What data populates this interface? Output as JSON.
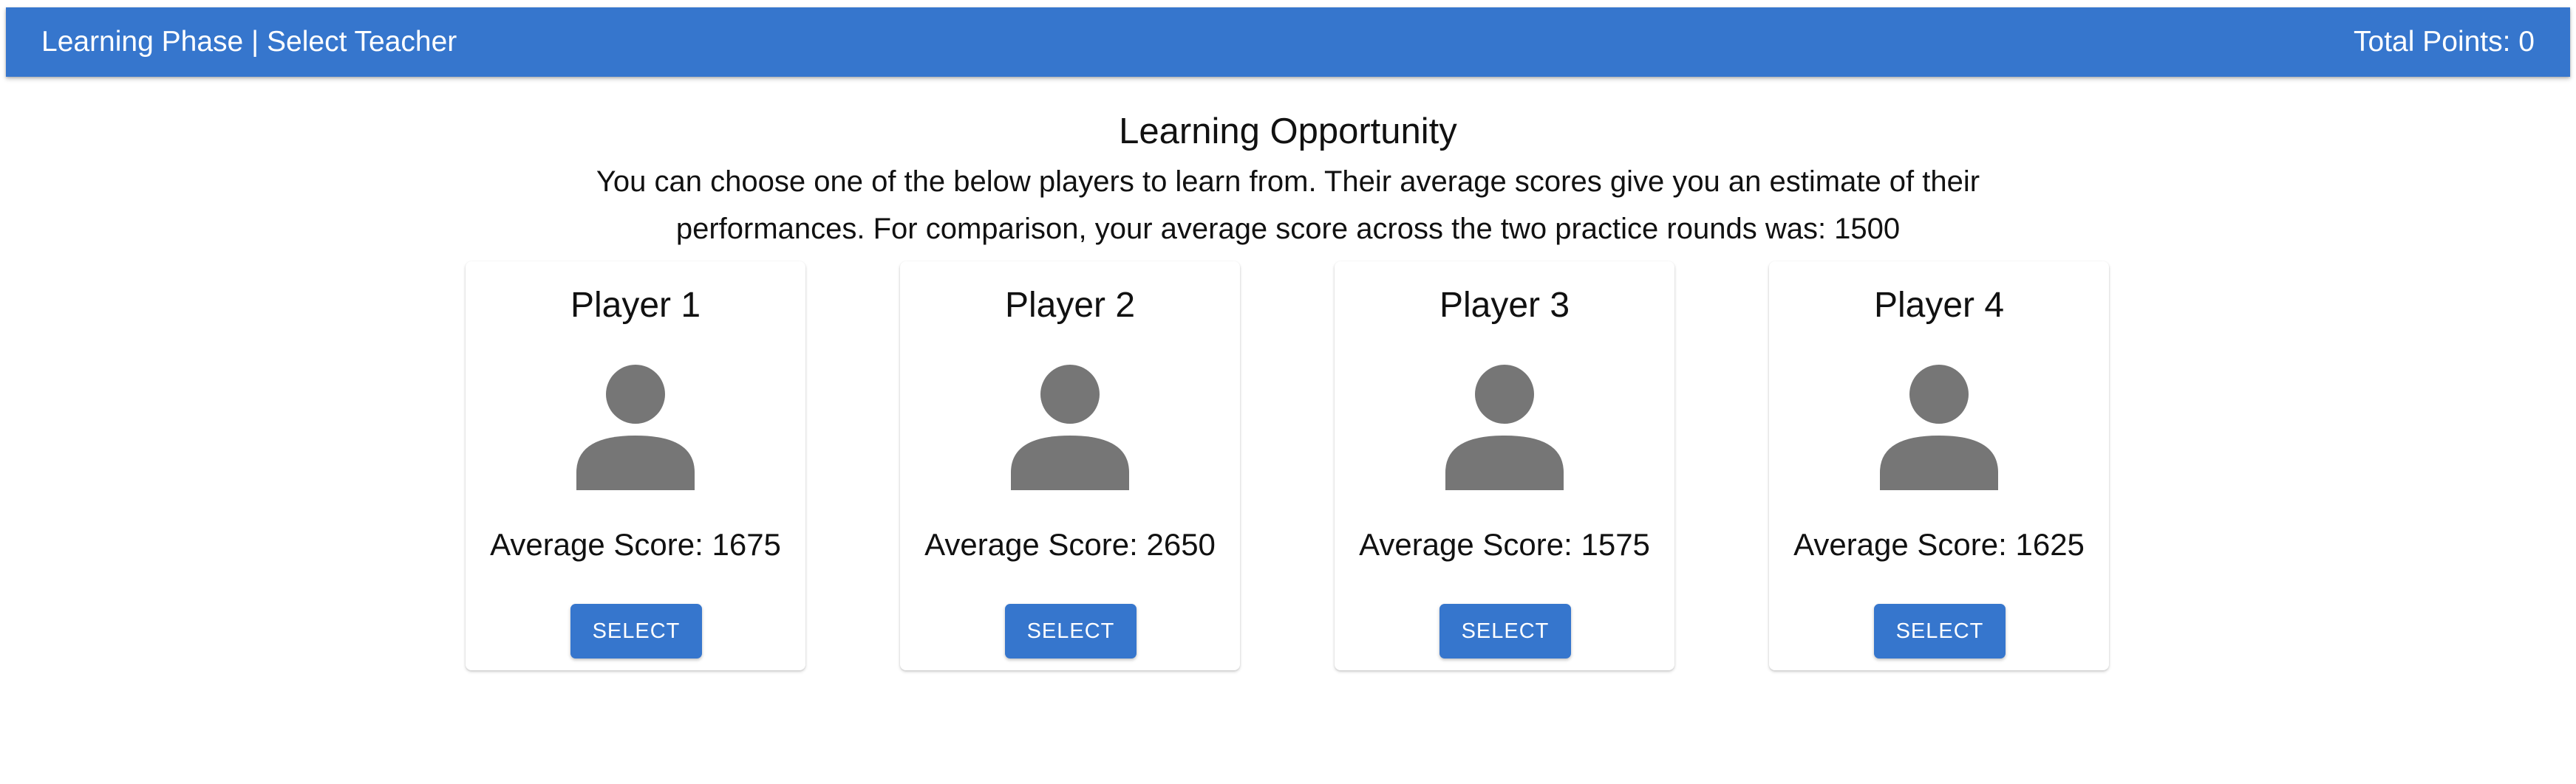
{
  "appbar": {
    "title": "Learning Phase | Select Teacher",
    "points": "Total Points: 0"
  },
  "main": {
    "heading": "Learning Opportunity",
    "description": "You can choose one of the below players to learn from. Their average scores give you an estimate of their performances. For comparison, your average score across the two practice rounds was: 1500"
  },
  "players": [
    {
      "name": "Player 1",
      "score": "Average Score: 1675",
      "button": "SELECT",
      "icon": "person-icon"
    },
    {
      "name": "Player 2",
      "score": "Average Score: 2650",
      "button": "SELECT",
      "icon": "person-icon"
    },
    {
      "name": "Player 3",
      "score": "Average Score: 1575",
      "button": "SELECT",
      "icon": "person-icon"
    },
    {
      "name": "Player 4",
      "score": "Average Score: 1625",
      "button": "SELECT",
      "icon": "person-icon"
    }
  ],
  "colors": {
    "accent": "#3676cd",
    "avatar": "#767676"
  }
}
